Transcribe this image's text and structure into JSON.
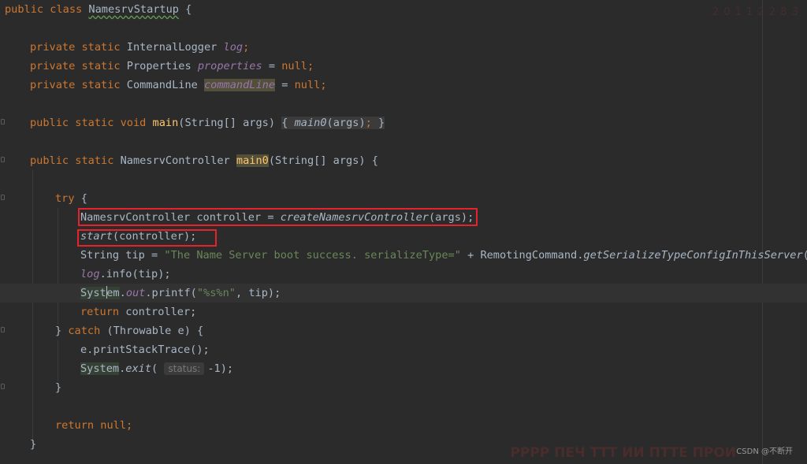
{
  "editor": {
    "file": "NamesrvStartup",
    "tokens": {
      "public": "public",
      "private": "private",
      "static": "static",
      "class_kw": "class",
      "void_kw": "void",
      "try_kw": "try",
      "catch_kw": "catch",
      "return_kw": "return",
      "null_kw": "null",
      "class_name": "NamesrvStartup",
      "internal_logger": "InternalLogger",
      "log": "log",
      "properties_type": "Properties",
      "properties_field": "properties",
      "command_line_type": "CommandLine",
      "command_line_field": "commandLine",
      "main": "main",
      "main0": "main0",
      "string_args": "(String[] args)",
      "args_call": "(args);",
      "controller_type": "NamesrvController",
      "controller_var": "controller",
      "create_controller": "createNamesrvController",
      "start": "start",
      "start_args": "(controller);",
      "string_tip": "String tip = ",
      "tip_literal": "\"The Name Server boot success. serializeType=\"",
      "plus_remoting": " + RemotingCommand.",
      "get_serialize": "getSerializeTypeConfigInThisServer",
      "call_end": "();",
      "info": ".info(tip);",
      "system": "System",
      "out": "out",
      "printf": ".printf(",
      "printf_format": "\"%s%n\"",
      "printf_tail": ", tip);",
      "return_controller": " controller;",
      "throwable": "(Throwable e) {",
      "print_stack_trace": "e.printStackTrace();",
      "exit": "exit",
      "status_hint": "status:",
      "exit_arg": "-1);"
    }
  },
  "watermark": {
    "top": "2 0 1 1 2 2 8 3",
    "bottom": "PPPP ПЕЧ ТТТ ИИ  ПТТЕ ПРОИ",
    "csdn": "CSDN @不断开"
  }
}
